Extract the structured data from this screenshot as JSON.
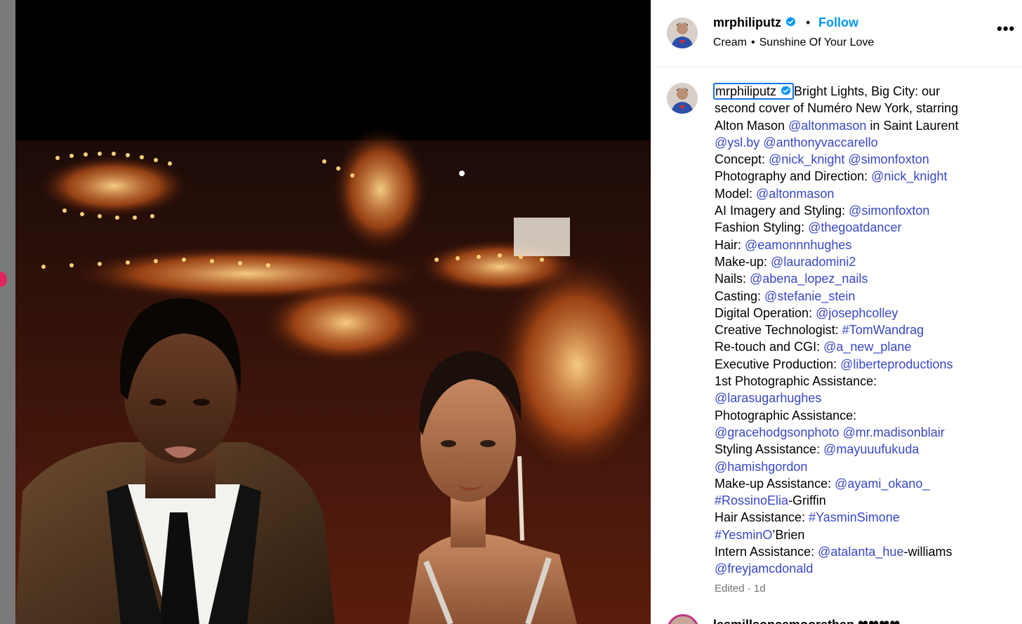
{
  "post": {
    "username": "mrphiliputz",
    "separator": "•",
    "follow_label": "Follow",
    "music_artist": "Cream",
    "music_sep": "•",
    "music_track": "Sunshine Of Your Love",
    "more_label": "•••"
  },
  "caption": {
    "username": "mrphiliputz",
    "l1": "Bright Lights, Big City: our",
    "l2": "second cover of Numéro New York, starring",
    "l3a": "Alton Mason ",
    "l3b": "@altonmason",
    "l3c": " in Saint Laurent",
    "l4a": "@ysl.by",
    "l4b": "@anthonyvaccarello",
    "l5a": "Concept: ",
    "l5b": "@nick_knight",
    "l5c": "@simonfoxton",
    "l6a": "Photography and Direction: ",
    "l6b": "@nick_knight",
    "l7a": "Model: ",
    "l7b": "@altonmason",
    "l8a": "AI Imagery and Styling: ",
    "l8b": "@simonfoxton",
    "l9a": "Fashion Styling: ",
    "l9b": "@thegoatdancer",
    "l10a": "Hair: ",
    "l10b": "@eamonnnhughes",
    "l11a": "Make-up: ",
    "l11b": "@lauradomini2",
    "l12a": "Nails: ",
    "l12b": "@abena_lopez_nails",
    "l13a": "Casting: ",
    "l13b": "@stefanie_stein",
    "l14a": "Digital Operation: ",
    "l14b": "@josephcolley",
    "l15a": "Creative Technologist: ",
    "l15b": "#TomWandrag",
    "l16a": "Re-touch and CGI: ",
    "l16b": "@a_new_plane",
    "l17a": "Executive Production: ",
    "l17b": "@liberteproductions",
    "l18": "1st Photographic Assistance:",
    "l19": "@larasugarhughes",
    "l20": "Photographic Assistance:",
    "l21a": "@gracehodgsonphoto",
    "l21b": "@mr.madisonblair",
    "l22a": "Styling Assistance: ",
    "l22b": "@mayuuufukuda",
    "l23": "@hamishgordon",
    "l24a": "Make-up Assistance: ",
    "l24b": "@ayami_okano_",
    "l25a": "#RossinoElia",
    "l25b": "-Griffin",
    "l26a": "Hair Assistance: ",
    "l26b": "#YasminSimone",
    "l27a": "#YesminO",
    "l27b": "’Brien",
    "l28a": "Intern Assistance: ",
    "l28b": "@atalanta_hue",
    "l28c": "-williams",
    "l29": "@freyjamcdonald",
    "edited": "Edited · 1d"
  },
  "next_comment": {
    "text": "lesmillsoncemoorethan ❤❤❤❤"
  },
  "colors": {
    "link": "#3847c9",
    "follow": "#0095f6",
    "verified": "#0095f6",
    "focus_outline": "#1a73e8"
  },
  "icons": [
    "verified-badge-icon",
    "more-options-icon"
  ]
}
